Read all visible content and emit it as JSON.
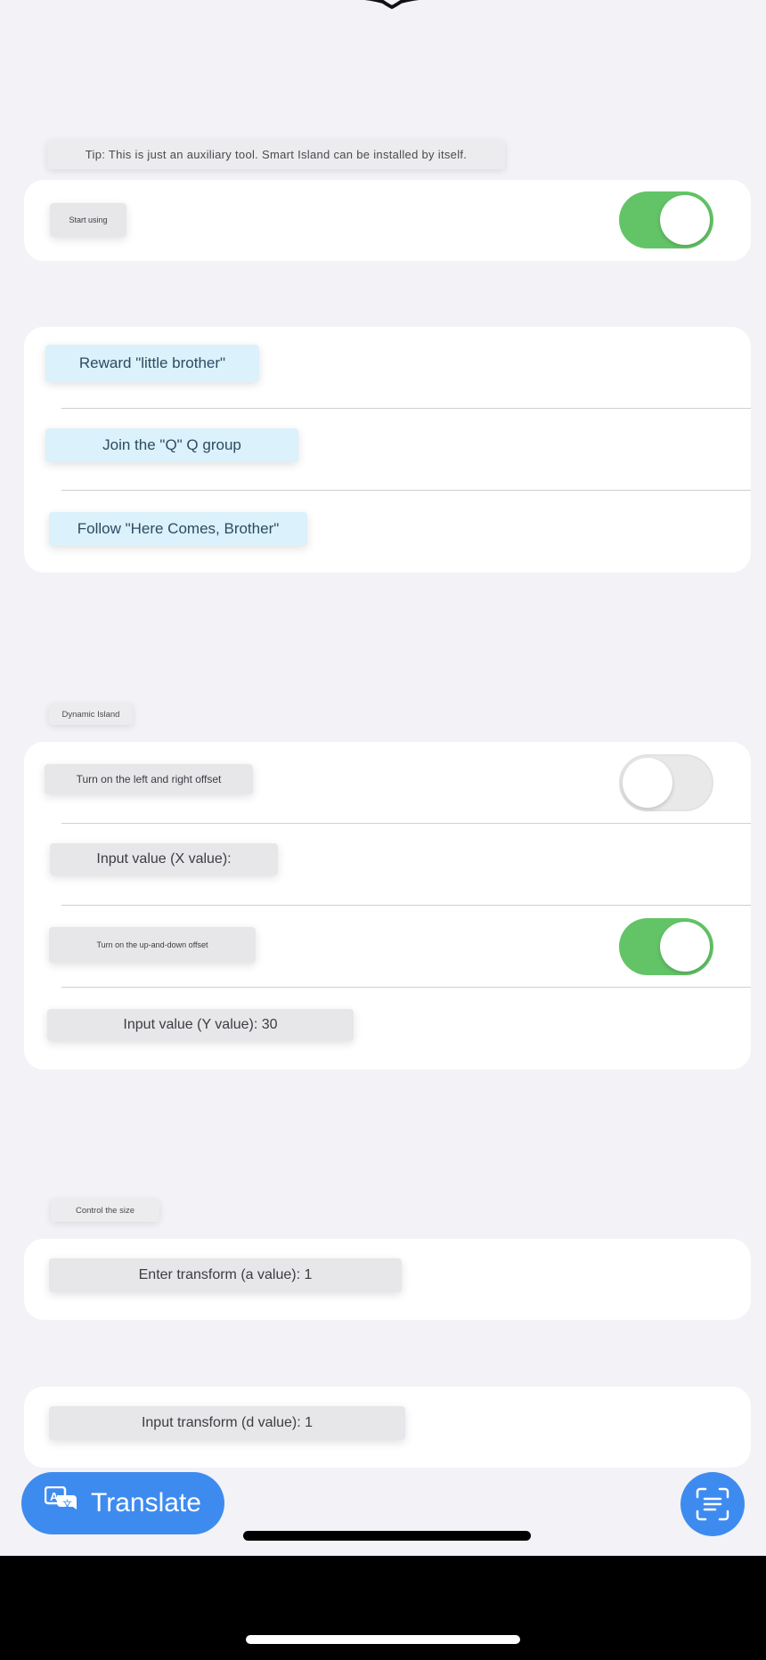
{
  "tip": "Tip: This is just an auxiliary tool. Smart Island can be installed by itself.",
  "start": {
    "label": "Start using",
    "enabled": true
  },
  "links": [
    {
      "label": "Reward \"little brother\""
    },
    {
      "label": "Join the \"Q\" Q group"
    },
    {
      "label": "Follow \"Here Comes, Brother\""
    }
  ],
  "dynamic_island": {
    "section_label": "Dynamic Island",
    "lr_offset_label": "Turn on the left and right offset",
    "lr_offset_enabled": false,
    "x_value_label": "Input value (X value):",
    "ud_offset_label": "Turn on the up-and-down offset",
    "ud_offset_enabled": true,
    "y_value_label": "Input value (Y value): 30"
  },
  "size": {
    "section_label": "Control the size",
    "a_value_label": "Enter transform (a value): 1",
    "d_value_label": "Input transform (d value): 1"
  },
  "bottom": {
    "translate_label": "Translate",
    "translate_icon": "translate-icon",
    "scan_icon": "text-scan-icon"
  },
  "colors": {
    "toggle_on": "#62c466",
    "accent": "#3e8bf0",
    "link_bg": "#dbf1fb"
  }
}
